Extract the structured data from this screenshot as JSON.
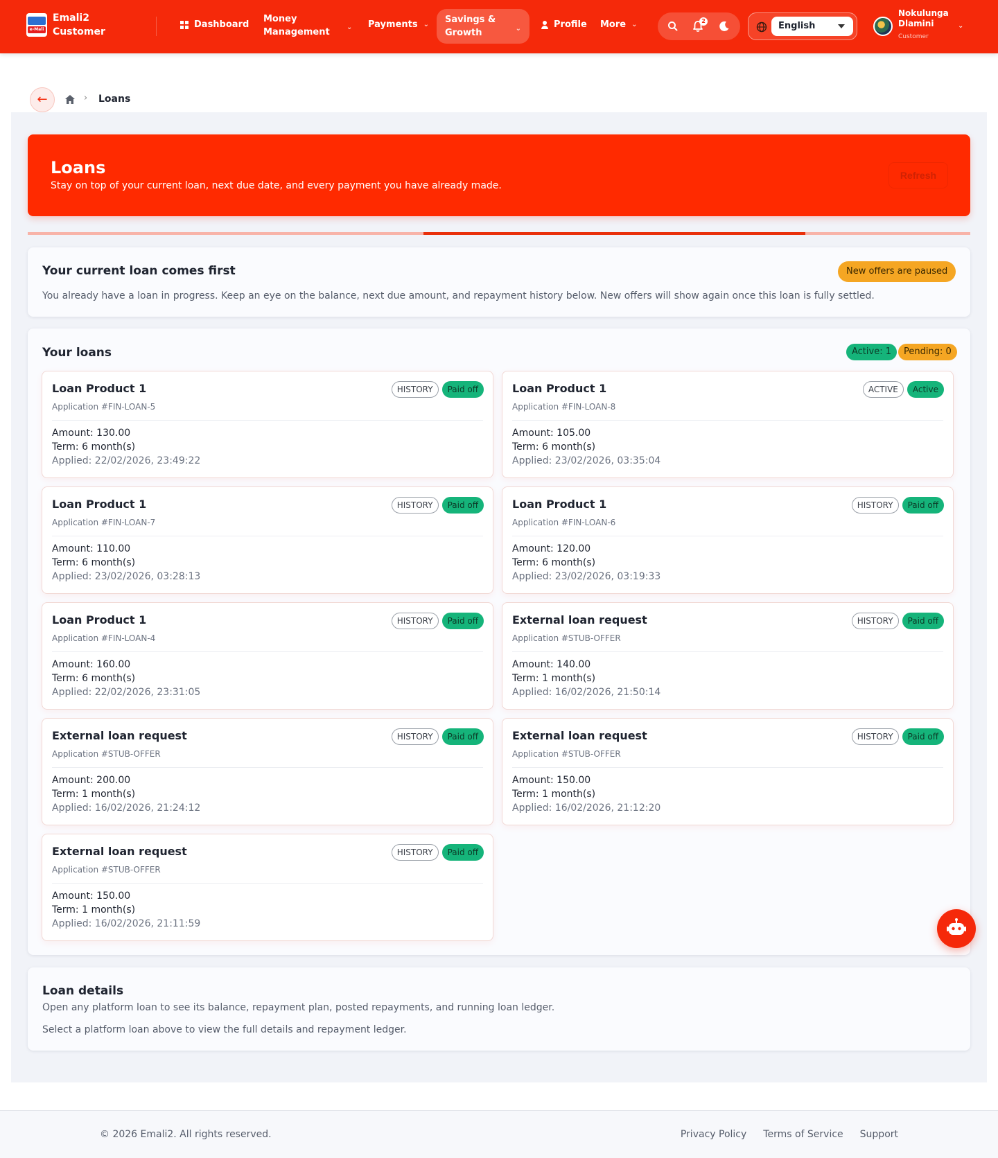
{
  "app": {
    "brand_line1": "Emali2",
    "brand_line2": "Customer",
    "logo_text": "e-Mali"
  },
  "nav": {
    "dashboard": "Dashboard",
    "money_line1": "Money",
    "money_line2": "Management",
    "payments": "Payments",
    "savings_line1": "Savings &",
    "savings_line2": "Growth",
    "profile": "Profile",
    "more": "More"
  },
  "notifications": {
    "count": "2"
  },
  "language": {
    "selected": "English"
  },
  "user": {
    "name_line1": "Nokulunga",
    "name_line2": "Dlamini",
    "role": "Customer"
  },
  "breadcrumb": {
    "back": "←",
    "current": "Loans"
  },
  "hero": {
    "title": "Loans",
    "subtitle": "Stay on top of your current loan, next due date, and every payment you have already made.",
    "refresh": "Refresh"
  },
  "progress": {
    "start": 0.42,
    "end": 0.825
  },
  "notice": {
    "title": "Your current loan comes first",
    "text": "You already have a loan in progress. Keep an eye on the balance, next due amount, and repayment history below. New offers will show again once this loan is fully settled.",
    "badge": "New offers are paused"
  },
  "loans": {
    "title": "Your loans",
    "active_count": "Active: 1",
    "pending_count": "Pending: 0",
    "items": [
      {
        "name": "Loan Product 1",
        "application": "Application #FIN-LOAN-5",
        "kind": "HISTORY",
        "status": "Paid off",
        "amount": "Amount: 130.00",
        "term": "Term: 6 month(s)",
        "applied": "Applied: 22/02/2026, 23:49:22"
      },
      {
        "name": "Loan Product 1",
        "application": "Application #FIN-LOAN-8",
        "kind": "ACTIVE",
        "status": "Active",
        "amount": "Amount: 105.00",
        "term": "Term: 6 month(s)",
        "applied": "Applied: 23/02/2026, 03:35:04"
      },
      {
        "name": "Loan Product 1",
        "application": "Application #FIN-LOAN-7",
        "kind": "HISTORY",
        "status": "Paid off",
        "amount": "Amount: 110.00",
        "term": "Term: 6 month(s)",
        "applied": "Applied: 23/02/2026, 03:28:13"
      },
      {
        "name": "Loan Product 1",
        "application": "Application #FIN-LOAN-6",
        "kind": "HISTORY",
        "status": "Paid off",
        "amount": "Amount: 120.00",
        "term": "Term: 6 month(s)",
        "applied": "Applied: 23/02/2026, 03:19:33"
      },
      {
        "name": "Loan Product 1",
        "application": "Application #FIN-LOAN-4",
        "kind": "HISTORY",
        "status": "Paid off",
        "amount": "Amount: 160.00",
        "term": "Term: 6 month(s)",
        "applied": "Applied: 22/02/2026, 23:31:05"
      },
      {
        "name": "External loan request",
        "application": "Application #STUB-OFFER",
        "kind": "HISTORY",
        "status": "Paid off",
        "amount": "Amount: 140.00",
        "term": "Term: 1 month(s)",
        "applied": "Applied: 16/02/2026, 21:50:14"
      },
      {
        "name": "External loan request",
        "application": "Application #STUB-OFFER",
        "kind": "HISTORY",
        "status": "Paid off",
        "amount": "Amount: 200.00",
        "term": "Term: 1 month(s)",
        "applied": "Applied: 16/02/2026, 21:24:12"
      },
      {
        "name": "External loan request",
        "application": "Application #STUB-OFFER",
        "kind": "HISTORY",
        "status": "Paid off",
        "amount": "Amount: 150.00",
        "term": "Term: 1 month(s)",
        "applied": "Applied: 16/02/2026, 21:12:20"
      },
      {
        "name": "External loan request",
        "application": "Application #STUB-OFFER",
        "kind": "HISTORY",
        "status": "Paid off",
        "amount": "Amount: 150.00",
        "term": "Term: 1 month(s)",
        "applied": "Applied: 16/02/2026, 21:11:59"
      }
    ]
  },
  "details": {
    "title": "Loan details",
    "subtitle": "Open any platform loan to see its balance, repayment plan, posted repayments, and running loan ledger.",
    "hint": "Select a platform loan above to view the full details and repayment ledger."
  },
  "footer": {
    "copyright": "© 2026 Emali2. All rights reserved.",
    "privacy": "Privacy Policy",
    "terms": "Terms of Service",
    "support": "Support"
  },
  "colors": {
    "brand": "#f5290a",
    "success": "#15b47a",
    "warning": "#f5a623"
  },
  "icons": [
    "dashboard-icon",
    "chevron-down-icon",
    "person-icon",
    "search-icon",
    "bell-icon",
    "moon-icon",
    "globe-icon",
    "home-icon",
    "back-arrow-icon",
    "robot-icon"
  ]
}
